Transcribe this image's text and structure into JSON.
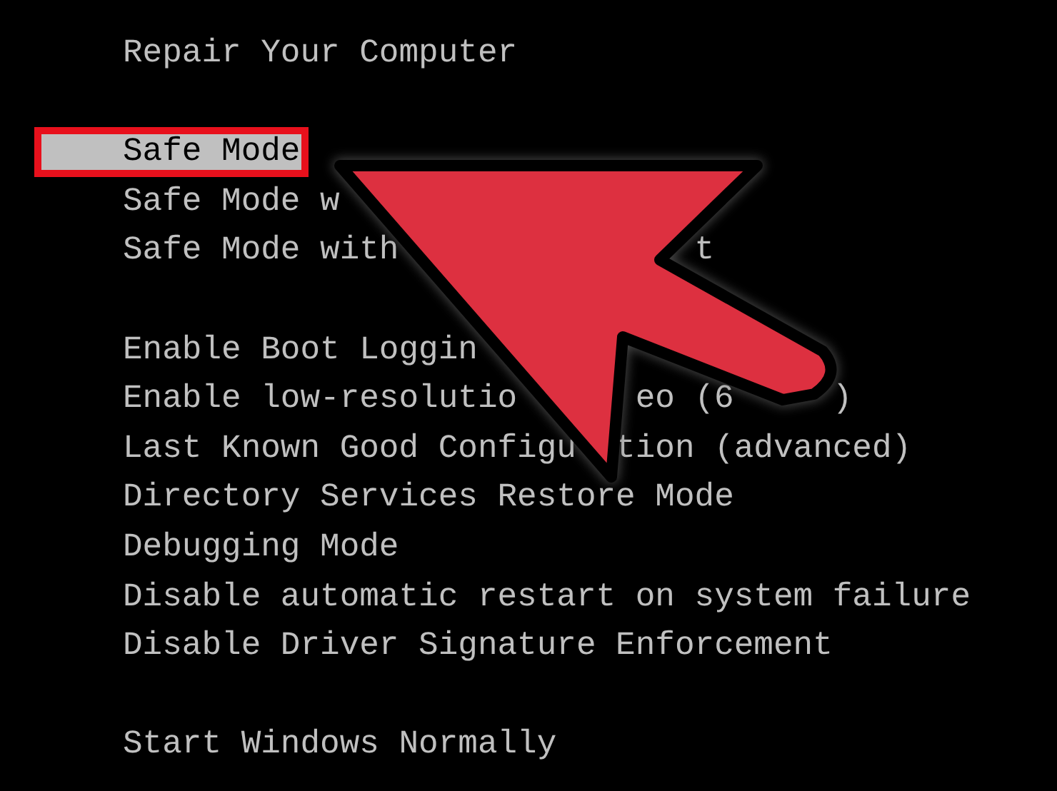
{
  "menu": [
    {
      "kind": "entry",
      "segments": [
        "Repair Your Computer"
      ],
      "selected": false,
      "framed": false
    },
    {
      "kind": "spacer"
    },
    {
      "kind": "entry",
      "segments": [
        "Safe Mode"
      ],
      "selected": true,
      "framed": true
    },
    {
      "kind": "entry",
      "segments": [
        "Safe Mode w"
      ],
      "selected": false,
      "framed": false
    },
    {
      "kind": "entry",
      "segments": [
        "Safe Mode with",
        "t"
      ],
      "selected": false,
      "framed": false
    },
    {
      "kind": "spacer"
    },
    {
      "kind": "entry",
      "segments": [
        "Enable Boot Loggin"
      ],
      "selected": false,
      "framed": false
    },
    {
      "kind": "entry",
      "segments": [
        "Enable low-resolutio",
        "eo (6",
        ")"
      ],
      "selected": false,
      "framed": false
    },
    {
      "kind": "entry",
      "segments": [
        "Last Known Good Configu",
        "tion (advanced)"
      ],
      "selected": false,
      "framed": false
    },
    {
      "kind": "entry",
      "segments": [
        "Directory Services Restore Mode"
      ],
      "selected": false,
      "framed": false
    },
    {
      "kind": "entry",
      "segments": [
        "Debugging Mode"
      ],
      "selected": false,
      "framed": false
    },
    {
      "kind": "entry",
      "segments": [
        "Disable automatic restart on system failure"
      ],
      "selected": false,
      "framed": false
    },
    {
      "kind": "entry",
      "segments": [
        "Disable Driver Signature Enforcement"
      ],
      "selected": false,
      "framed": false
    },
    {
      "kind": "spacer"
    },
    {
      "kind": "entry",
      "segments": [
        "Start Windows Normally"
      ],
      "selected": false,
      "framed": false
    }
  ]
}
